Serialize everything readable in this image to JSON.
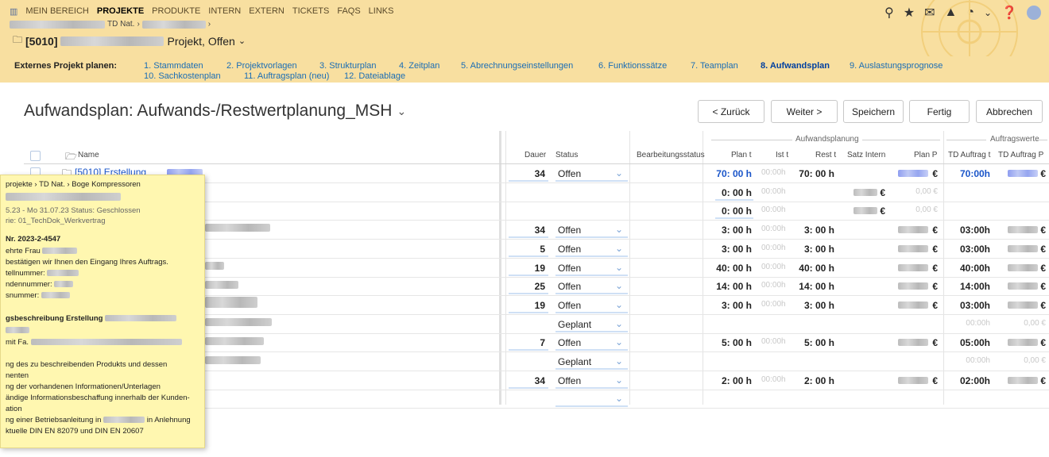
{
  "topnav": [
    "MEIN BEREICH",
    "PROJEKTE",
    "PRODUKTE",
    "INTERN",
    "EXTERN",
    "TICKETS",
    "FAQS",
    "LINKS"
  ],
  "breadcrumb": {
    "seg2": "TD Nat."
  },
  "project": {
    "id": "[5010]",
    "suffix": "Projekt, Offen"
  },
  "wizard": {
    "label": "Externes Projekt planen:",
    "steps": [
      "1. Stammdaten",
      "2. Projektvorlagen",
      "3. Strukturplan",
      "4. Zeitplan",
      "5. Abrechnungseinstellungen",
      "6. Funktionssätze",
      "7. Teamplan",
      "8. Aufwandsplan",
      "9. Auslastungsprognose",
      "10. Sachkostenplan",
      "11. Auftragsplan (neu)",
      "12. Dateiablage"
    ]
  },
  "page": {
    "title": "Aufwandsplan: Aufwands-/Restwertplanung_MSH"
  },
  "buttons": {
    "back": "< Zurück",
    "next": "Weiter >",
    "save": "Speichern",
    "done": "Fertig",
    "cancel": "Abbrechen"
  },
  "table": {
    "group_plan": "Aufwandsplanung",
    "group_order": "Auftragswerte",
    "headers": {
      "name": "Name",
      "dauer": "Dauer",
      "status": "Status",
      "bearb": "Bearbeitungsstatus",
      "plan_t": "Plan t",
      "ist_t": "Ist t",
      "rest_t": "Rest t",
      "satz": "Satz Intern",
      "plan_p": "Plan P",
      "td_t": "TD Auftrag t",
      "td_p": "TD Auftrag P"
    },
    "first_row_name": "[5010] Erstellung",
    "rows": [
      {
        "dauer": "34",
        "status": "Offen",
        "plan": "70: 00 h",
        "ist": "00:00h",
        "rest": "70: 00 h",
        "satz": "",
        "planp": "€",
        "tdt": "70:00h",
        "tdp": "€"
      },
      {
        "dauer": "",
        "status": "",
        "plan": "0: 00 h",
        "ist": "00:00h",
        "rest": "",
        "satz": "€",
        "planp": "0,00 €",
        "tdt": "",
        "tdp": ""
      },
      {
        "dauer": "",
        "status": "",
        "plan": "0: 00 h",
        "ist": "00:00h",
        "rest": "",
        "satz": "€",
        "planp": "0,00 €",
        "tdt": "",
        "tdp": ""
      },
      {
        "dauer": "34",
        "status": "Offen",
        "plan": "3: 00 h",
        "ist": "00:00h",
        "rest": "3: 00 h",
        "satz": "",
        "planp": "€",
        "tdt": "03:00h",
        "tdp": "€"
      },
      {
        "dauer": "5",
        "status": "Offen",
        "plan": "3: 00 h",
        "ist": "00:00h",
        "rest": "3: 00 h",
        "satz": "",
        "planp": "€",
        "tdt": "03:00h",
        "tdp": "€"
      },
      {
        "dauer": "19",
        "status": "Offen",
        "plan": "40: 00 h",
        "ist": "00:00h",
        "rest": "40: 00 h",
        "satz": "",
        "planp": "€",
        "tdt": "40:00h",
        "tdp": "€"
      },
      {
        "dauer": "25",
        "status": "Offen",
        "plan": "14: 00 h",
        "ist": "00:00h",
        "rest": "14: 00 h",
        "satz": "",
        "planp": "€",
        "tdt": "14:00h",
        "tdp": "€"
      },
      {
        "dauer": "19",
        "status": "Offen",
        "plan": "3: 00 h",
        "ist": "00:00h",
        "rest": "3: 00 h",
        "satz": "",
        "planp": "€",
        "tdt": "03:00h",
        "tdp": "€"
      },
      {
        "dauer": "",
        "status": "Geplant",
        "plan": "",
        "ist": "",
        "rest": "",
        "satz": "",
        "planp": "",
        "tdt": "00:00h",
        "tdp": "0,00 €"
      },
      {
        "dauer": "7",
        "status": "Offen",
        "plan": "5: 00 h",
        "ist": "00:00h",
        "rest": "5: 00 h",
        "satz": "",
        "planp": "€",
        "tdt": "05:00h",
        "tdp": "€"
      },
      {
        "dauer": "",
        "status": "Geplant",
        "plan": "",
        "ist": "",
        "rest": "",
        "satz": "",
        "planp": "",
        "tdt": "00:00h",
        "tdp": "0,00 €"
      },
      {
        "dauer": "34",
        "status": "Offen",
        "plan": "2: 00 h",
        "ist": "00:00h",
        "rest": "2: 00 h",
        "satz": "",
        "planp": "€",
        "tdt": "02:00h",
        "tdp": "€"
      },
      {
        "dauer": "",
        "status": "",
        "plan": "",
        "ist": "",
        "rest": "",
        "satz": "",
        "planp": "",
        "tdt": "",
        "tdp": ""
      }
    ]
  },
  "tooltip": {
    "path": "projekte › TD Nat. › Boge Kompressoren",
    "dates": "5.23 - Mo 31.07.23   Status: Geschlossen",
    "category": "rie: 01_TechDok_Werkvertrag",
    "number": "Nr. 2023-2-4547",
    "l1": "ehrte Frau",
    "l2": "bestätigen wir Ihnen den Eingang Ihres Auftrags.",
    "l3": "tellnummer:",
    "l4": "ndennummer:",
    "l5": "snummer:",
    "l6": "gsbeschreibung Erstellung",
    "l7": "mit Fa.",
    "l8": "ng des zu beschreibenden Produkts und dessen",
    "l9": "nenten",
    "l10": "ng der vorhandenen Informationen/Unterlagen",
    "l11": "ändige Informationsbeschaffung innerhalb der Kunden-",
    "l12": "ation",
    "l13": "ng einer Betriebsanleitung in",
    "l13b": "in Anlehnung",
    "l14": "ktuelle DIN EN 82079 und DIN EN 20607"
  }
}
